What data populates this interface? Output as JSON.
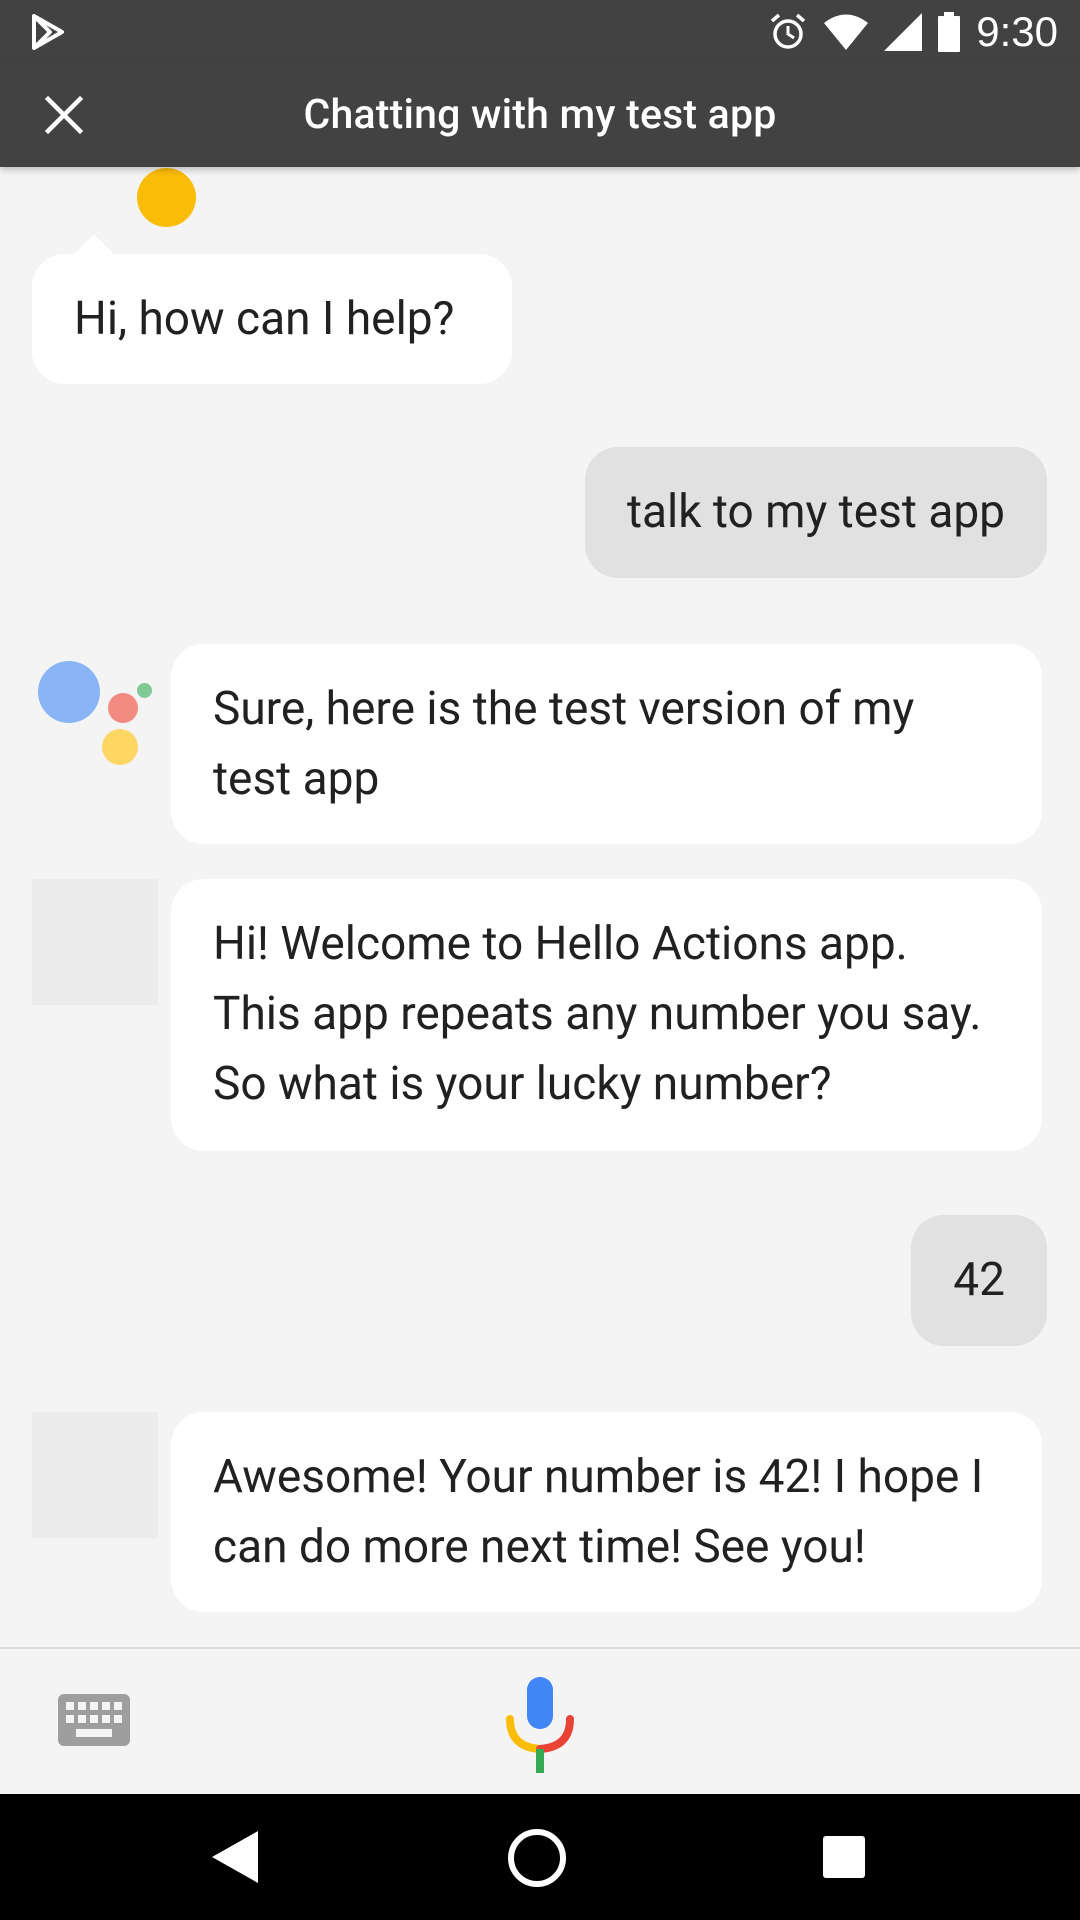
{
  "status_bar": {
    "time": "9:30",
    "icons": [
      "play-store-icon",
      "alarm-icon",
      "wifi-icon",
      "signal-icon",
      "battery-icon"
    ]
  },
  "header": {
    "title": "Chatting with my test app",
    "close_icon": "close-icon"
  },
  "messages": [
    {
      "sender": "assistant",
      "text": "Hi, how can I help?"
    },
    {
      "sender": "user",
      "text": "talk to my test app"
    },
    {
      "sender": "assistant",
      "text": "Sure, here is the test version of my test app"
    },
    {
      "sender": "app",
      "text": "Hi! Welcome to Hello Actions app. This app repeats any number you say. So what is your lucky number?"
    },
    {
      "sender": "user",
      "text": "42"
    },
    {
      "sender": "app",
      "text": "Awesome! Your number is 42! I hope I can do more next time! See you!"
    }
  ],
  "input_bar": {
    "keyboard_icon": "keyboard-icon",
    "mic_icon": "mic-icon"
  },
  "nav_bar": {
    "icons": [
      "back-icon",
      "home-icon",
      "recents-icon"
    ]
  },
  "colors": {
    "app_bar": "#424242",
    "background": "#f4f4f4",
    "assistant_bubble": "#ffffff",
    "user_bubble": "#e1e1e1",
    "google_blue": "#4285f4",
    "google_red": "#ea4335",
    "google_yellow": "#fbbc05",
    "google_green": "#34a853"
  }
}
